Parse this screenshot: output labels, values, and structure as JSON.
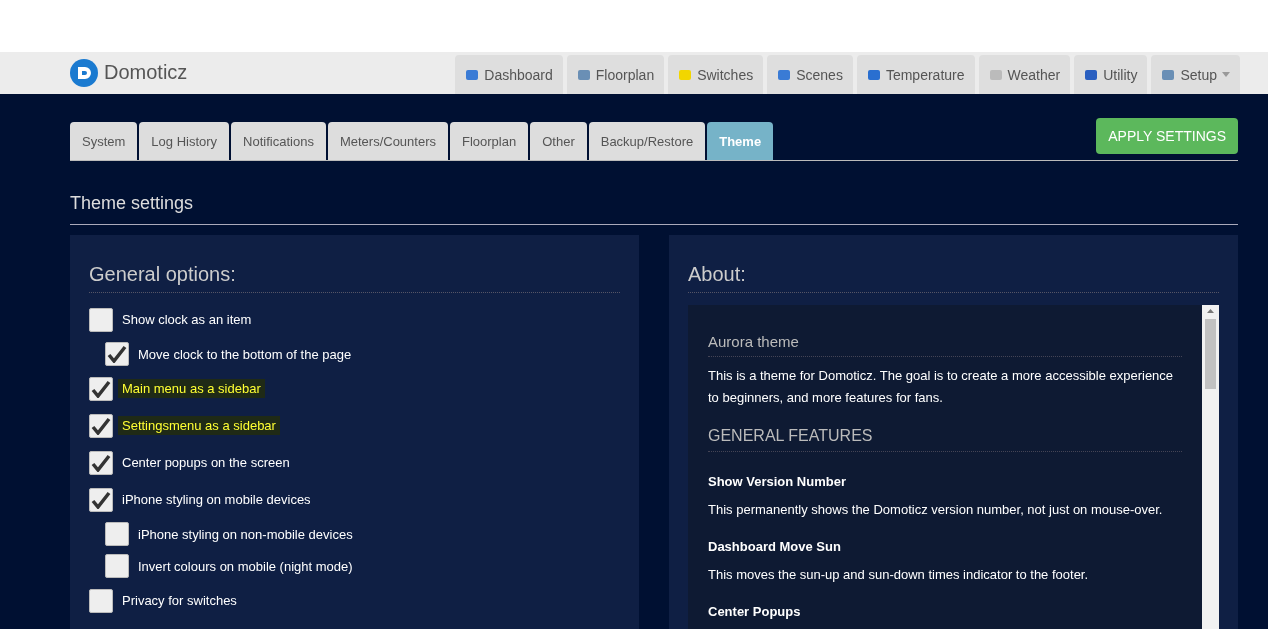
{
  "brand": {
    "name": "Domoticz"
  },
  "nav": [
    {
      "label": "Dashboard",
      "selected": false
    },
    {
      "label": "Floorplan",
      "selected": false
    },
    {
      "label": "Switches",
      "selected": false
    },
    {
      "label": "Scenes",
      "selected": false
    },
    {
      "label": "Temperature",
      "selected": false
    },
    {
      "label": "Weather",
      "selected": false
    },
    {
      "label": "Utility",
      "selected": false
    },
    {
      "label": "Setup",
      "selected": false,
      "dropdown": true
    }
  ],
  "tabs": [
    {
      "label": "System",
      "selected": false
    },
    {
      "label": "Log History",
      "selected": false
    },
    {
      "label": "Notifications",
      "selected": false
    },
    {
      "label": "Meters/Counters",
      "selected": false
    },
    {
      "label": "Floorplan",
      "selected": false
    },
    {
      "label": "Other",
      "selected": false
    },
    {
      "label": "Backup/Restore",
      "selected": false
    },
    {
      "label": "Theme",
      "selected": true
    }
  ],
  "apply_button": "APPLY SETTINGS",
  "section_title": "Theme settings",
  "general": {
    "title": "General options:",
    "options": [
      {
        "label": "Show clock as an item",
        "checked": false,
        "highlighted": false,
        "children": [
          {
            "label": "Move clock to the bottom of the page",
            "checked": true,
            "highlighted": false
          }
        ]
      },
      {
        "label": "Main menu as a sidebar",
        "checked": true,
        "highlighted": true
      },
      {
        "label": "Settingsmenu as a sidebar",
        "checked": true,
        "highlighted": true
      },
      {
        "label": "Center popups on the screen",
        "checked": true,
        "highlighted": false
      },
      {
        "label": "iPhone styling on mobile devices",
        "checked": true,
        "highlighted": false,
        "children": [
          {
            "label": "iPhone styling on non-mobile devices",
            "checked": false,
            "highlighted": false
          },
          {
            "label": "Invert colours on mobile (night mode)",
            "checked": false,
            "highlighted": false
          }
        ]
      },
      {
        "label": "Privacy for switches",
        "checked": false,
        "highlighted": false
      }
    ]
  },
  "about": {
    "title": "About:",
    "blocks": [
      {
        "kind": "heading",
        "text": "Aurora theme"
      },
      {
        "kind": "paragraph",
        "text": "This is a theme for Domoticz. The goal is to create a more accessible experience to beginners, and more features for fans."
      },
      {
        "kind": "heading",
        "text": "GENERAL FEATURES"
      },
      {
        "kind": "subheading",
        "text": "Show Version Number"
      },
      {
        "kind": "paragraph",
        "text": "This permanently shows the Domoticz version number, not just on mouse-over."
      },
      {
        "kind": "subheading",
        "text": "Dashboard Move Sun"
      },
      {
        "kind": "paragraph",
        "text": "This moves the sun-up and sun-down times indicator to the footer."
      },
      {
        "kind": "subheading",
        "text": "Center Popups"
      }
    ]
  }
}
